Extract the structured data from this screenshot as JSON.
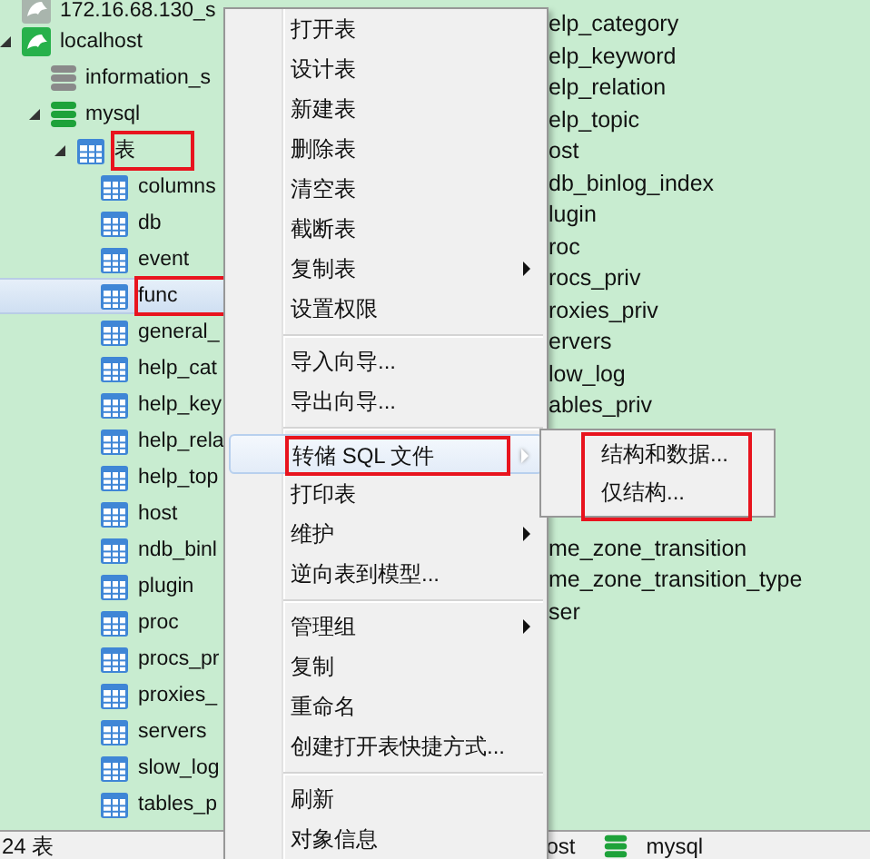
{
  "tree": [
    {
      "label": "172.16.68.130_s",
      "kind": "connection",
      "open": false,
      "selected": false
    },
    {
      "label": "localhost",
      "kind": "connection",
      "open": true,
      "expanded": true,
      "selected": false,
      "children": [
        {
          "label": "information_s",
          "kind": "database",
          "open": false,
          "selected": false
        },
        {
          "label": "mysql",
          "kind": "database",
          "open": true,
          "expanded": true,
          "selected": false,
          "children": [
            {
              "label": "表",
              "kind": "tables",
              "expanded": true,
              "selected": false,
              "annotated": true,
              "children": [
                {
                  "label": "columns",
                  "kind": "table",
                  "selected": false
                },
                {
                  "label": "db",
                  "kind": "table",
                  "selected": false
                },
                {
                  "label": "event",
                  "kind": "table",
                  "selected": false
                },
                {
                  "label": "func",
                  "kind": "table",
                  "selected": true,
                  "annotated": true
                },
                {
                  "label": "general_",
                  "kind": "table",
                  "selected": false
                },
                {
                  "label": "help_cat",
                  "kind": "table",
                  "selected": false
                },
                {
                  "label": "help_key",
                  "kind": "table",
                  "selected": false
                },
                {
                  "label": "help_rela",
                  "kind": "table",
                  "selected": false
                },
                {
                  "label": "help_top",
                  "kind": "table",
                  "selected": false
                },
                {
                  "label": "host",
                  "kind": "table",
                  "selected": false
                },
                {
                  "label": "ndb_binl",
                  "kind": "table",
                  "selected": false
                },
                {
                  "label": "plugin",
                  "kind": "table",
                  "selected": false
                },
                {
                  "label": "proc",
                  "kind": "table",
                  "selected": false
                },
                {
                  "label": "procs_pr",
                  "kind": "table",
                  "selected": false
                },
                {
                  "label": "proxies_",
                  "kind": "table",
                  "selected": false
                },
                {
                  "label": "servers",
                  "kind": "table",
                  "selected": false
                },
                {
                  "label": "slow_log",
                  "kind": "table",
                  "selected": false
                },
                {
                  "label": "tables_p",
                  "kind": "table",
                  "selected": false
                }
              ]
            }
          ]
        }
      ]
    }
  ],
  "object_list": {
    "rows": [
      "elp_category",
      "elp_keyword",
      "elp_relation",
      "elp_topic",
      "ost",
      "db_binlog_index",
      "lugin",
      "roc",
      "rocs_priv",
      "roxies_priv",
      "ervers",
      "low_log",
      "ables_priv"
    ],
    "rows_after_submenu": [
      "me_zone_transition",
      "me_zone_transition_type",
      "ser"
    ]
  },
  "context_menu": [
    {
      "kind": "item",
      "label": "打开表",
      "submenu": false,
      "highlighted": false
    },
    {
      "kind": "item",
      "label": "设计表",
      "submenu": false,
      "highlighted": false
    },
    {
      "kind": "item",
      "label": "新建表",
      "submenu": false,
      "highlighted": false
    },
    {
      "kind": "item",
      "label": "删除表",
      "submenu": false,
      "highlighted": false
    },
    {
      "kind": "item",
      "label": "清空表",
      "submenu": false,
      "highlighted": false
    },
    {
      "kind": "item",
      "label": "截断表",
      "submenu": false,
      "highlighted": false
    },
    {
      "kind": "item",
      "label": "复制表",
      "submenu": true,
      "highlighted": false
    },
    {
      "kind": "item",
      "label": "设置权限",
      "submenu": false,
      "highlighted": false
    },
    {
      "kind": "separator"
    },
    {
      "kind": "item",
      "label": "导入向导...",
      "submenu": false,
      "highlighted": false
    },
    {
      "kind": "item",
      "label": "导出向导...",
      "submenu": false,
      "highlighted": false
    },
    {
      "kind": "separator"
    },
    {
      "kind": "item",
      "label": "转储 SQL 文件",
      "submenu": true,
      "highlighted": true,
      "annotated": true
    },
    {
      "kind": "item",
      "label": "打印表",
      "submenu": false,
      "highlighted": false
    },
    {
      "kind": "item",
      "label": "维护",
      "submenu": true,
      "highlighted": false
    },
    {
      "kind": "item",
      "label": "逆向表到模型...",
      "submenu": false,
      "highlighted": false
    },
    {
      "kind": "separator"
    },
    {
      "kind": "item",
      "label": "管理组",
      "submenu": true,
      "highlighted": false
    },
    {
      "kind": "item",
      "label": "复制",
      "submenu": false,
      "highlighted": false
    },
    {
      "kind": "item",
      "label": "重命名",
      "submenu": false,
      "highlighted": false
    },
    {
      "kind": "item",
      "label": "创建打开表快捷方式...",
      "submenu": false,
      "highlighted": false
    },
    {
      "kind": "separator"
    },
    {
      "kind": "item",
      "label": "刷新",
      "submenu": false,
      "highlighted": false
    },
    {
      "kind": "item",
      "label": "对象信息",
      "submenu": false,
      "highlighted": false
    }
  ],
  "submenu": {
    "annotated": true,
    "items": [
      "结构和数据...",
      "仅结构..."
    ]
  },
  "status_bar": {
    "count": "24 表",
    "connection": "ost",
    "database": "mysql"
  }
}
